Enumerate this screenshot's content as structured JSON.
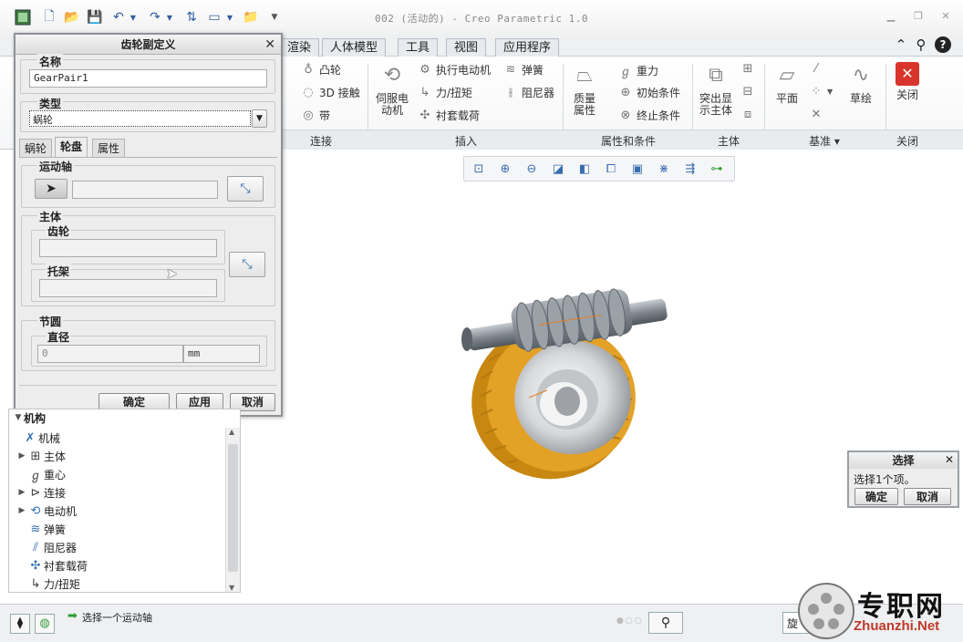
{
  "window": {
    "title": "002 (活动的) - Creo Parametric 1.0"
  },
  "ribbon": {
    "tabs": [
      "渲染",
      "人体模型",
      "工具",
      "视图",
      "应用程序"
    ],
    "connect": {
      "cam": "凸轮",
      "contact3d": "3D 接触",
      "belt": "带"
    },
    "insert": {
      "servo": "伺服电动机",
      "servo_line1": "伺服电",
      "servo_line2": "动机",
      "actuator": "执行电动机",
      "force": "力/扭矩",
      "bushing": "衬套载荷",
      "spring": "弹簧",
      "damper": "阻尼器"
    },
    "props": {
      "mass_line1": "质量",
      "mass_line2": "属性",
      "gravity": "重力",
      "initial": "初始条件",
      "terminate": "终止条件"
    },
    "body": {
      "highlight_line1": "突出显",
      "highlight_line2": "示主体"
    },
    "datum": {
      "plane": "平面",
      "sketch": "草绘"
    },
    "close": {
      "label": "关闭"
    },
    "groups": {
      "connect": "连接",
      "insert": "插入",
      "props": "属性和条件",
      "body": "主体",
      "datum": "基准 ▾",
      "close": "关闭"
    }
  },
  "gear_dialog": {
    "title": "齿轮副定义",
    "name_label": "名称",
    "name_value": "GearPair1",
    "type_label": "类型",
    "type_value": "蜗轮",
    "tabs": [
      "蜗轮",
      "轮盘",
      "属性"
    ],
    "motion_axis_label": "运动轴",
    "body_label": "主体",
    "gear_label": "齿轮",
    "carrier_label": "托架",
    "pitch_circle_label": "节圆",
    "diameter_label": "直径",
    "diameter_value": "0",
    "diameter_unit": "mm",
    "ok": "确定",
    "apply": "应用",
    "cancel": "取消"
  },
  "model_tree": {
    "header": "机构",
    "items": [
      {
        "label": "机械",
        "expandable": false,
        "icon": "mechanism-icon"
      },
      {
        "label": "主体",
        "expandable": true,
        "icon": "body-icon"
      },
      {
        "label": "重心",
        "expandable": false,
        "icon": "gravity-icon"
      },
      {
        "label": "连接",
        "expandable": true,
        "icon": "connection-icon"
      },
      {
        "label": "电动机",
        "expandable": true,
        "icon": "motor-icon"
      },
      {
        "label": "弹簧",
        "expandable": false,
        "icon": "spring-icon"
      },
      {
        "label": "阻尼器",
        "expandable": false,
        "icon": "damper-icon"
      },
      {
        "label": "衬套载荷",
        "expandable": false,
        "icon": "bushing-icon"
      },
      {
        "label": "力/扭矩",
        "expandable": false,
        "icon": "force-icon"
      }
    ]
  },
  "select_dialog": {
    "title": "选择",
    "message": "选择1个项。",
    "ok": "确定",
    "cancel": "取消"
  },
  "status": {
    "message": "选择一个运动轴",
    "filter_partial": "旋"
  },
  "watermark": {
    "cn": "专职网",
    "url": "Zhuanzhi.Net"
  },
  "colors": {
    "gear_orange": "#e3a126",
    "worm_gray": "#8f969d",
    "close_red": "#d9342b"
  }
}
